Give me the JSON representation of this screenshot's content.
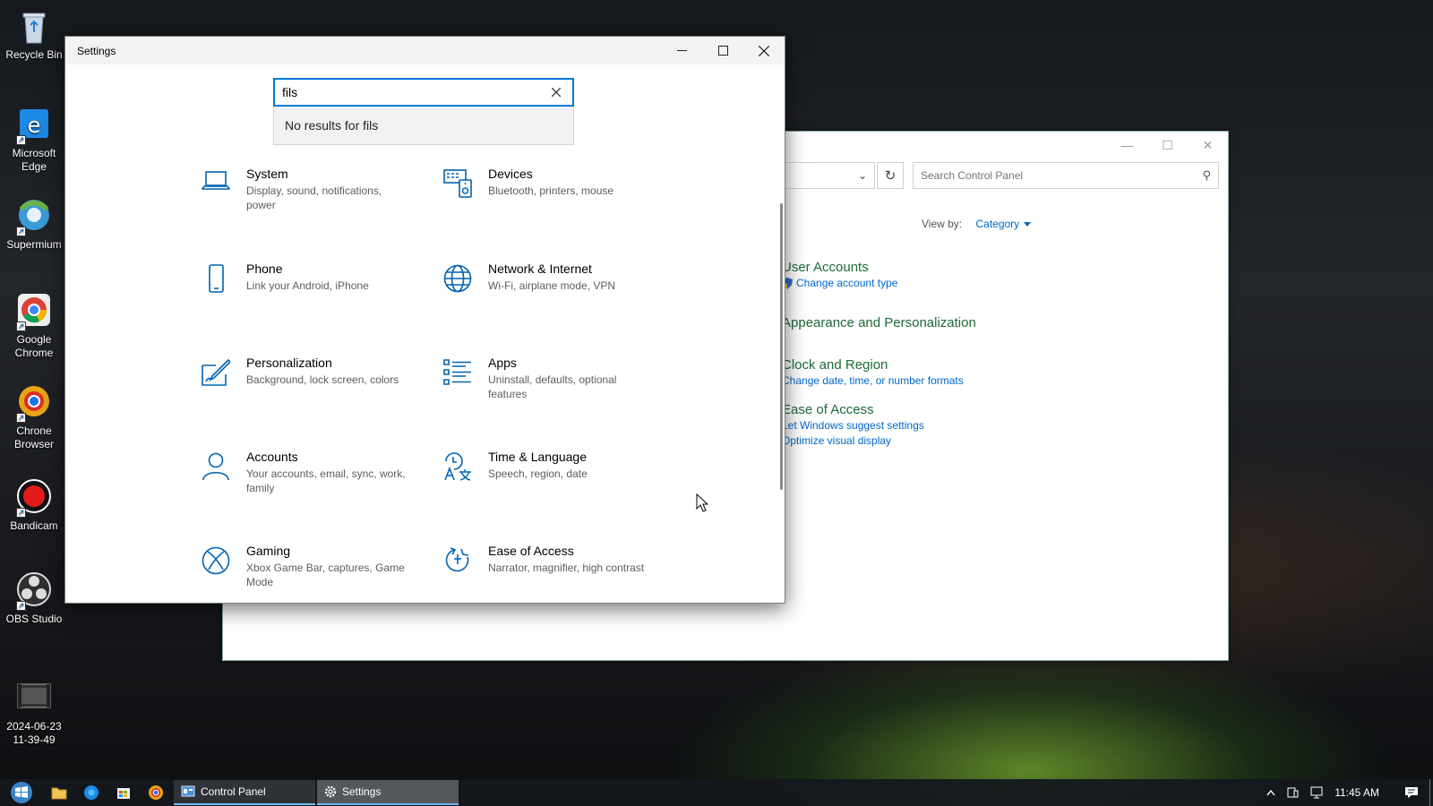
{
  "desktop": {
    "icons": [
      {
        "label": "Recycle Bin"
      },
      {
        "label": "Microsoft Edge"
      },
      {
        "label": "Supermium"
      },
      {
        "label": "Google Chrome"
      },
      {
        "label": "Chrone Browser"
      },
      {
        "label": "Bandicam"
      },
      {
        "label": "OBS Studio"
      },
      {
        "label": "2024-06-23 11-39-49"
      }
    ]
  },
  "control_panel": {
    "search_placeholder": "Search Control Panel",
    "view_by_label": "View by:",
    "view_by_value": "Category",
    "categories": [
      {
        "heading": "User Accounts",
        "links": [
          "Change account type"
        ]
      },
      {
        "heading": "Appearance and Personalization",
        "links": []
      },
      {
        "heading": "Clock and Region",
        "links": [
          "Change date, time, or number formats"
        ]
      },
      {
        "heading": "Ease of Access",
        "links": [
          "Let Windows suggest settings",
          "Optimize visual display"
        ]
      }
    ]
  },
  "settings": {
    "title": "Settings",
    "search_value": "fils",
    "no_results": "No results for fils",
    "tiles": [
      {
        "name": "System",
        "desc": "Display, sound, notifications, power"
      },
      {
        "name": "Devices",
        "desc": "Bluetooth, printers, mouse"
      },
      {
        "name": "Phone",
        "desc": "Link your Android, iPhone"
      },
      {
        "name": "Network & Internet",
        "desc": "Wi-Fi, airplane mode, VPN"
      },
      {
        "name": "Personalization",
        "desc": "Background, lock screen, colors"
      },
      {
        "name": "Apps",
        "desc": "Uninstall, defaults, optional features"
      },
      {
        "name": "Accounts",
        "desc": "Your accounts, email, sync, work, family"
      },
      {
        "name": "Time & Language",
        "desc": "Speech, region, date"
      },
      {
        "name": "Gaming",
        "desc": "Xbox Game Bar, captures, Game Mode"
      },
      {
        "name": "Ease of Access",
        "desc": "Narrator, magnifier, high contrast"
      }
    ]
  },
  "taskbar": {
    "apps": [
      {
        "label": "Control Panel"
      },
      {
        "label": "Settings"
      }
    ],
    "clock": "11:45 AM"
  },
  "colors": {
    "accent": "#0078d7",
    "icon_blue": "#0063b1",
    "cp_heading_green": "#1e6a39",
    "link_blue": "#0066cc"
  }
}
